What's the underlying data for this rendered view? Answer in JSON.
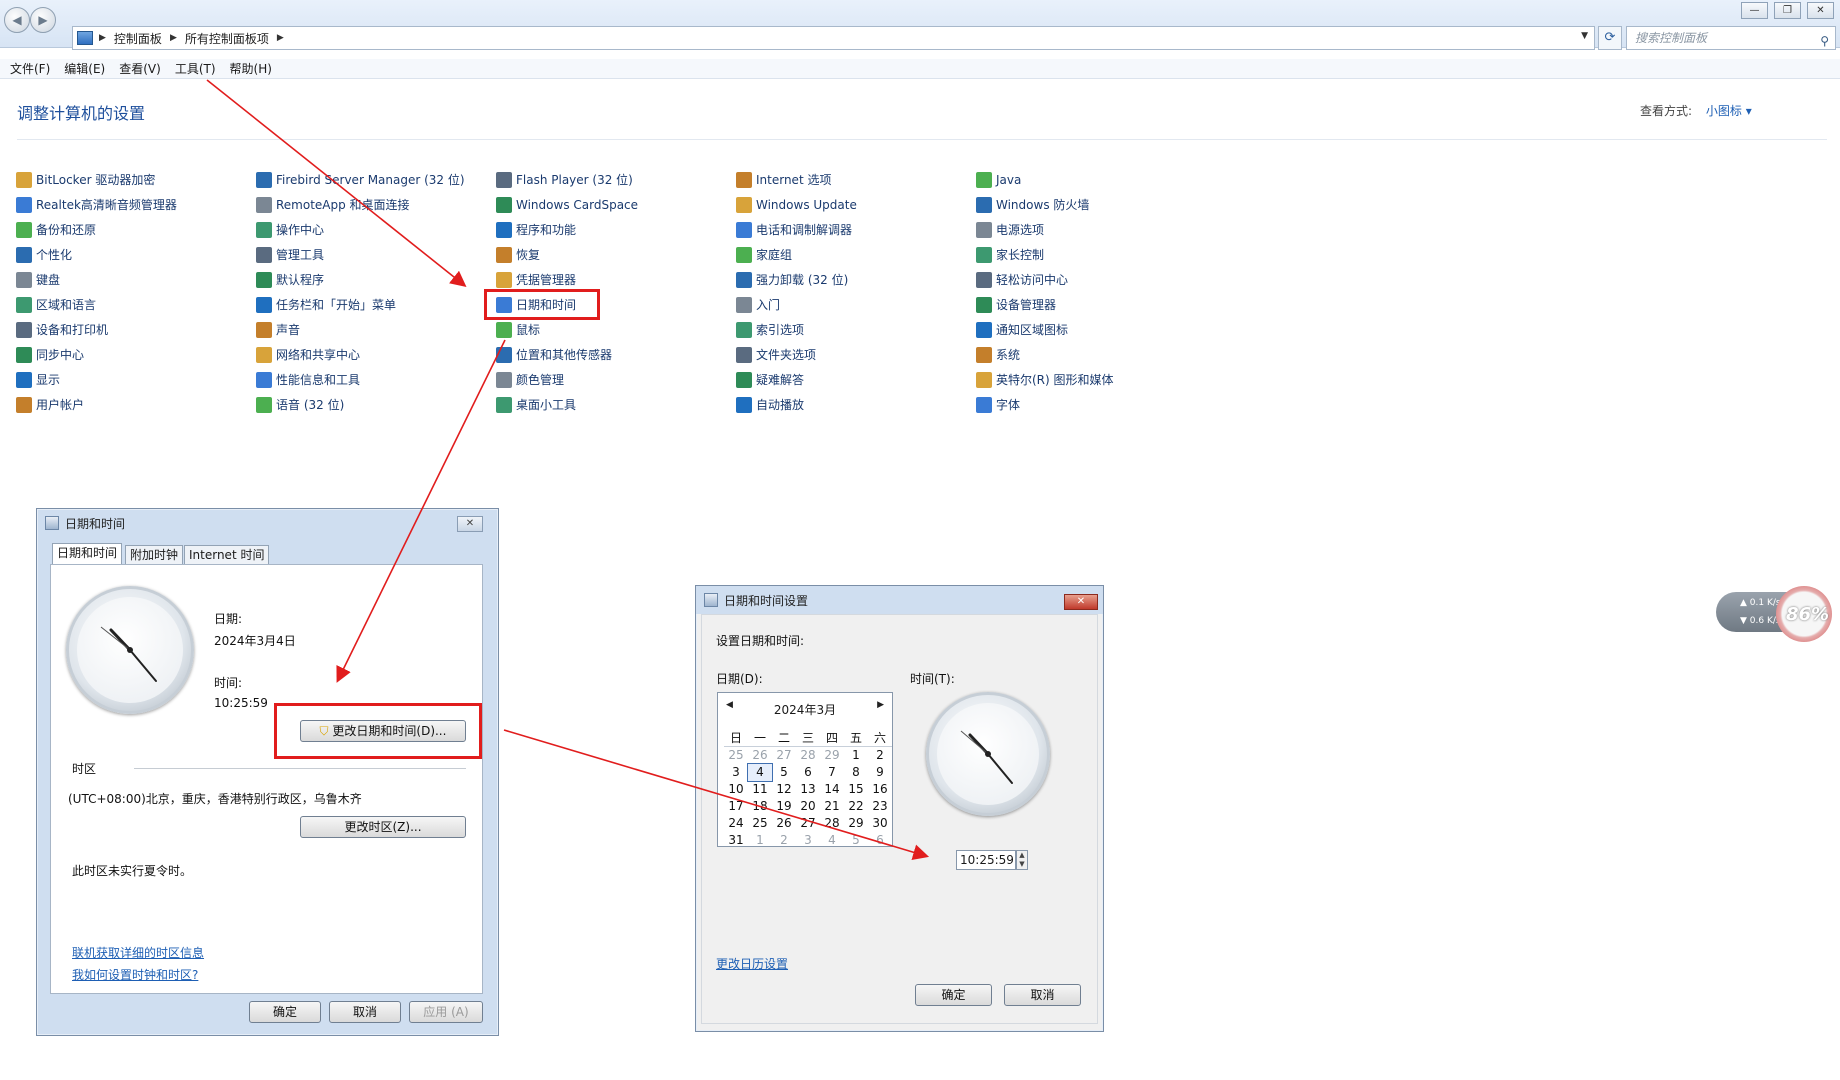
{
  "address": {
    "crumbs": [
      "控制面板",
      "所有控制面板项"
    ],
    "search_placeholder": "搜索控制面板"
  },
  "menu": [
    "文件(F)",
    "编辑(E)",
    "查看(V)",
    "工具(T)",
    "帮助(H)"
  ],
  "header": {
    "title": "调整计算机的设置",
    "view_label": "查看方式:",
    "view_value": "小图标 ▾"
  },
  "columns": [
    [
      "BitLocker 驱动器加密",
      "Realtek高清晰音频管理器",
      "备份和还原",
      "个性化",
      "键盘",
      "区域和语言",
      "设备和打印机",
      "同步中心",
      "显示",
      "用户帐户"
    ],
    [
      "Firebird Server Manager (32 位)",
      "RemoteApp 和桌面连接",
      "操作中心",
      "管理工具",
      "默认程序",
      "任务栏和「开始」菜单",
      "声音",
      "网络和共享中心",
      "性能信息和工具",
      "语音 (32 位)"
    ],
    [
      "Flash Player (32 位)",
      "Windows CardSpace",
      "程序和功能",
      "恢复",
      "凭据管理器",
      "日期和时间",
      "鼠标",
      "位置和其他传感器",
      "颜色管理",
      "桌面小工具"
    ],
    [
      "Internet 选项",
      "Windows Update",
      "电话和调制解调器",
      "家庭组",
      "强力卸载 (32 位)",
      "入门",
      "索引选项",
      "文件夹选项",
      "疑难解答",
      "自动播放"
    ],
    [
      "Java",
      "Windows 防火墙",
      "电源选项",
      "家长控制",
      "轻松访问中心",
      "设备管理器",
      "通知区域图标",
      "系统",
      "英特尔(R) 图形和媒体",
      "字体"
    ]
  ],
  "dialog1": {
    "title": "日期和时间",
    "tabs": [
      "日期和时间",
      "附加时钟",
      "Internet 时间"
    ],
    "date_label": "日期:",
    "date_value": "2024年3月4日",
    "time_label": "时间:",
    "time_value": "10:25:59",
    "change_datetime": "更改日期和时间(D)...",
    "timezone_label": "时区",
    "timezone_value": "(UTC+08:00)北京，重庆，香港特别行政区，乌鲁木齐",
    "change_timezone": "更改时区(Z)...",
    "dst_note": "此时区未实行夏令时。",
    "link1": "联机获取详细的时区信息",
    "link2": "我如何设置时钟和时区?",
    "ok": "确定",
    "cancel": "取消",
    "apply": "应用 (A)"
  },
  "dialog2": {
    "title": "日期和时间设置",
    "prompt": "设置日期和时间:",
    "date_label": "日期(D):",
    "time_label": "时间(T):",
    "month": "2024年3月",
    "weekdays": [
      "日",
      "一",
      "二",
      "三",
      "四",
      "五",
      "六"
    ],
    "weeks": [
      [
        "25",
        "26",
        "27",
        "28",
        "29",
        "1",
        "2"
      ],
      [
        "3",
        "4",
        "5",
        "6",
        "7",
        "8",
        "9"
      ],
      [
        "10",
        "11",
        "12",
        "13",
        "14",
        "15",
        "16"
      ],
      [
        "17",
        "18",
        "19",
        "20",
        "21",
        "22",
        "23"
      ],
      [
        "24",
        "25",
        "26",
        "27",
        "28",
        "29",
        "30"
      ],
      [
        "31",
        "1",
        "2",
        "3",
        "4",
        "5",
        "6"
      ]
    ],
    "time_value": "10:25:59",
    "calendar_link": "更改日历设置",
    "ok": "确定",
    "cancel": "取消"
  },
  "widget": {
    "up": "0.1",
    "down": "0.6",
    "unit": "K/s",
    "percent": "86%"
  },
  "colors": {
    "accent": "#1e5fb4",
    "highlight": "#e11d1d"
  }
}
